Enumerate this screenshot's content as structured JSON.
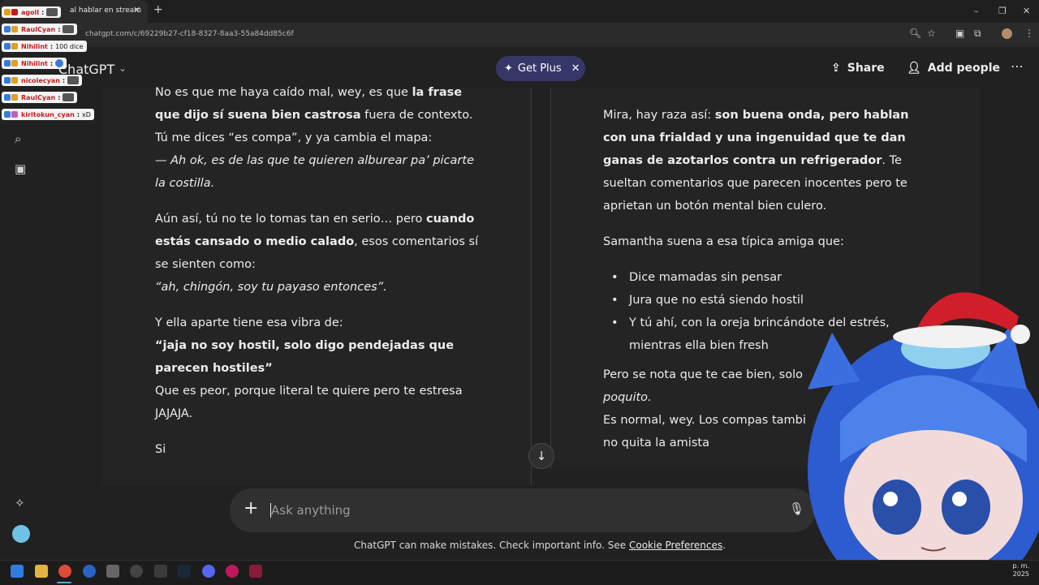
{
  "browser": {
    "tab_title": "al hablar en stream",
    "url": "chatgpt.com/c/69229b27-cf18-8327-8aa3-55a84dd85c6f"
  },
  "chat_overlay": [
    {
      "user": "agoll",
      "msg": ""
    },
    {
      "user": "RaulCyan",
      "msg": ""
    },
    {
      "user": "Nihilint",
      "msg": "100 dice"
    },
    {
      "user": "Nihilint",
      "msg": ""
    },
    {
      "user": "nicolecyan",
      "msg": ""
    },
    {
      "user": "RaulCyan",
      "msg": ""
    },
    {
      "user": "kiritokun_cyan",
      "msg": "xD"
    }
  ],
  "header": {
    "app_title": "ChatGPT",
    "get_plus": "Get Plus",
    "share": "Share",
    "add_people": "Add people"
  },
  "left": {
    "p1_a": "No es que me haya caído mal, wey, es que ",
    "p1_b": "la frase que dijo sí suena bien castrosa",
    "p1_c": " fuera de contexto.",
    "p1_d": "Tú me dices “es compa”, y ya cambia el mapa:",
    "p1_e": "— Ah ok, es de las que te quieren alburear pa’ picarte la costilla.",
    "p2_a": "Aún así, tú no te lo tomas tan en serio… pero ",
    "p2_b": "cuando estás cansado o medio calado",
    "p2_c": ", esos comentarios sí se sienten como:",
    "p2_d": "“ah, chingón, soy tu payaso entonces”.",
    "p3_a": "Y ella aparte tiene esa vibra de:",
    "p3_b": "“jaja no soy hostil, solo digo pendejadas que parecen hostiles”",
    "p3_c": "Que es peor, porque literal te quiere pero te estresa JAJAJA.",
    "p4": "Si"
  },
  "right": {
    "p1_a": "Mira, hay raza así: ",
    "p1_b": "son buena onda, pero hablan con una frialdad y una ingenuidad que te dan ganas de azotarlos contra un refrigerador",
    "p1_c": ". Te sueltan comentarios que parecen inocentes pero te aprietan un botón mental bien culero.",
    "p2": "Samantha suena a esa típica amiga que:",
    "bullets": [
      "Dice mamadas sin pensar",
      "Jura que no está siendo hostil",
      "Y tú ahí, con la oreja brincándote del estrés, mientras ella bien fresh"
    ],
    "p3_a": "Pero se nota que te cae bien, solo",
    "p3_b": "poquito.",
    "p4": "Es normal, wey. Los compas tambi",
    "p4_b": "no quita la amista"
  },
  "composer": {
    "placeholder": "Ask anything",
    "disclaimer_a": "ChatGPT can make mistakes. Check important info. See ",
    "disclaimer_link": "Cookie Preferences",
    "disclaimer_b": "."
  },
  "taskbar": {
    "clock_top": "p. m.",
    "clock_bottom": "2025"
  },
  "colors": {
    "page_bg": "#212121",
    "get_plus_bg": "#373669",
    "composer_bg": "#303030"
  }
}
